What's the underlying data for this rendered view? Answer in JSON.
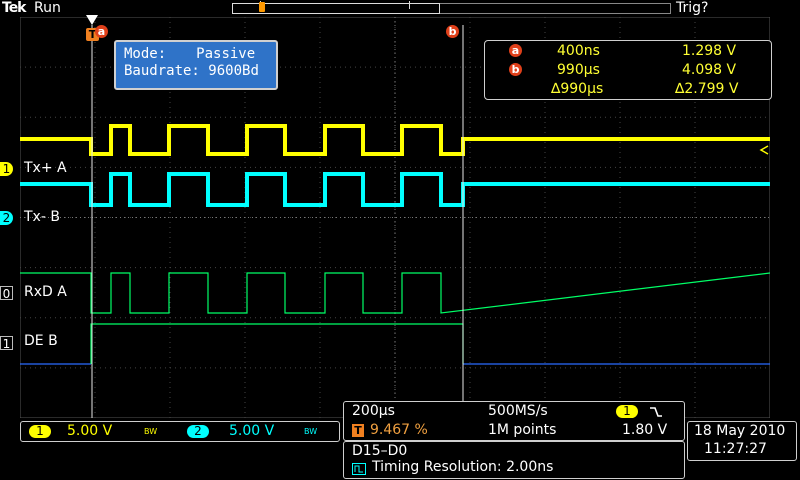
{
  "header": {
    "brand": "Tek",
    "acq_state": "Run",
    "trigger_status": "Trig?"
  },
  "cursors": {
    "a_label": "a",
    "b_label": "b",
    "a_time": "400ns",
    "a_value": "1.298 V",
    "b_time": "990µs",
    "b_value": "4.098 V",
    "delta_time": "∆990µs",
    "delta_value": "∆2.799 V"
  },
  "bus_decode": {
    "mode_label": "Mode:",
    "mode_value": "Passive",
    "baud_label": "Baudrate:",
    "baud_value": "9600Bd"
  },
  "channels": {
    "ch1": {
      "num": "1",
      "label": "Tx+ A",
      "color": "#ffff00"
    },
    "ch2": {
      "num": "2",
      "label": "Tx- B",
      "color": "#00ffff"
    },
    "d0": {
      "num": "0",
      "label": "RxD A",
      "color": "#00ff66"
    },
    "d1": {
      "num": "1",
      "label": "DE B",
      "color": "#2a6bff"
    }
  },
  "vertical": {
    "ch1_num": "1",
    "ch1_scale": "5.00 V",
    "ch1_bw": "BW",
    "ch2_num": "2",
    "ch2_scale": "5.00 V",
    "ch2_bw": "BW"
  },
  "horizontal": {
    "time_per_div": "200µs",
    "sample_rate": "500MS/s",
    "trigger_pos": "9.467 %",
    "record_length": "1M points",
    "trigger_source": "1",
    "trigger_level": "1.80 V",
    "trigger_marker": "T"
  },
  "digital": {
    "channels": "D15–D0",
    "timing_resolution": "Timing Resolution: 2.00ns"
  },
  "datetime": {
    "date": "18 May 2010",
    "time": "11:27:27"
  },
  "colors": {
    "ch1": "#ffff00",
    "ch2": "#00ffff",
    "digital_high": "#00ff66",
    "digital_low": "#2a6bff",
    "cursor": "#e0401a",
    "panel_blue": "#2f73c8"
  }
}
